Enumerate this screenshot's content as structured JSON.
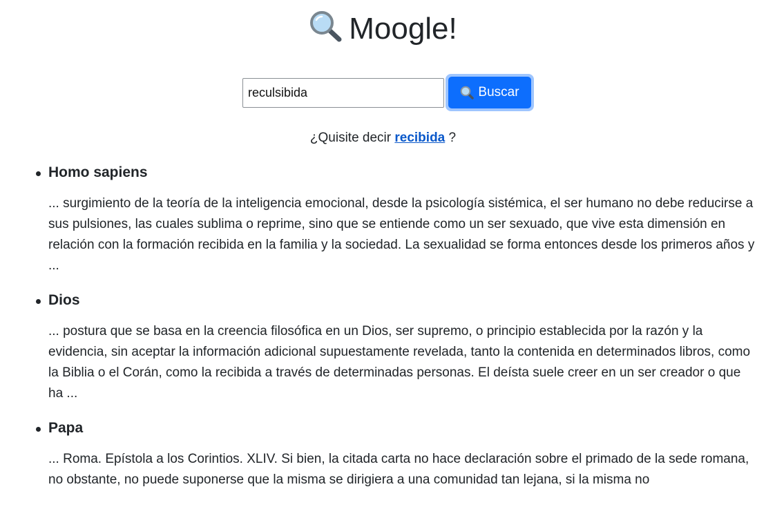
{
  "header": {
    "logo_icon": "magnifying-glass-icon",
    "title": "Moogle!"
  },
  "search": {
    "query": "reculsibida",
    "button_icon": "magnifying-glass-icon",
    "button_label": "Buscar"
  },
  "suggestion": {
    "prefix": "¿Quisite decir",
    "term": "recibida",
    "suffix": "?"
  },
  "results": [
    {
      "title": "Homo sapiens",
      "snippet": "... surgimiento de la teoría de la inteligencia emocional, desde la psicología sistémica, el ser humano no debe reducirse a sus pulsiones, las cuales sublima o reprime, sino que se entiende como un ser sexuado, que vive esta dimensión en relación con la formación recibida en la familia y la sociedad. La sexualidad se forma entonces desde los primeros años y ..."
    },
    {
      "title": "Dios",
      "snippet": "... postura que se basa en la creencia filosófica en un Dios, ser supremo, o principio establecida por la razón y la evidencia, sin aceptar la información adicional supuestamente revelada, tanto la contenida en determinados libros, como la Biblia o el Corán, como la recibida a través de determinadas personas. El deísta suele creer en un ser creador o que ha ..."
    },
    {
      "title": "Papa",
      "snippet": "... Roma. Epístola a los Corintios. XLIV.  Si bien, la citada carta no hace declaración sobre el primado de la sede romana, no obstante, no puede suponerse que la misma se dirigiera a una comunidad tan lejana, si la misma no"
    }
  ],
  "colors": {
    "accent": "#0d6efd",
    "focus_ring": "#9ec5fe",
    "link": "#0a58ca",
    "text": "#212529"
  }
}
